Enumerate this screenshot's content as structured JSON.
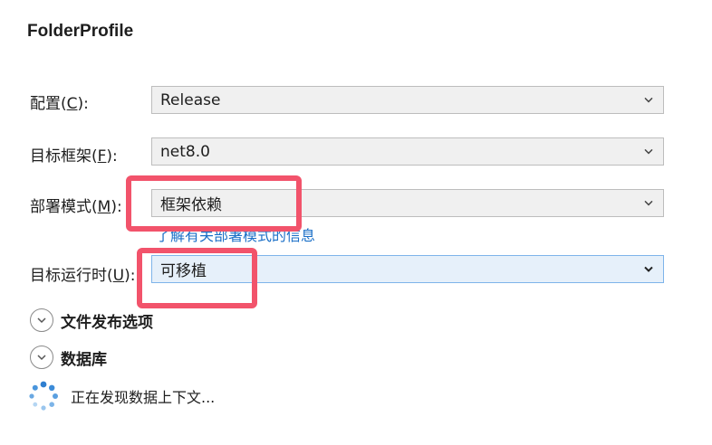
{
  "page_title": "FolderProfile",
  "fields": [
    {
      "label_before": "配置(",
      "mnemonic": "C",
      "label_after": "):",
      "value": "Release"
    },
    {
      "label_before": "目标框架(",
      "mnemonic": "F",
      "label_after": "):",
      "value": "net8.0"
    },
    {
      "label_before": "部署模式(",
      "mnemonic": "M",
      "label_after": "):",
      "value": "框架依赖"
    },
    {
      "label_before": "目标运行时(",
      "mnemonic": "U",
      "label_after": "):",
      "value": "可移植"
    }
  ],
  "deploy_mode_link": "了解有关部署模式的信息",
  "sections": [
    {
      "label": "文件发布选项",
      "icon": "chevron-down-icon"
    },
    {
      "label": "数据库",
      "icon": "chevron-down-icon"
    }
  ],
  "status_text": "正在发现数据上下文...",
  "colors": {
    "highlight": "#f2536b",
    "link": "#1a6fc7",
    "focus_border": "#7eb4ea",
    "spinner": "#2f7fd0"
  }
}
